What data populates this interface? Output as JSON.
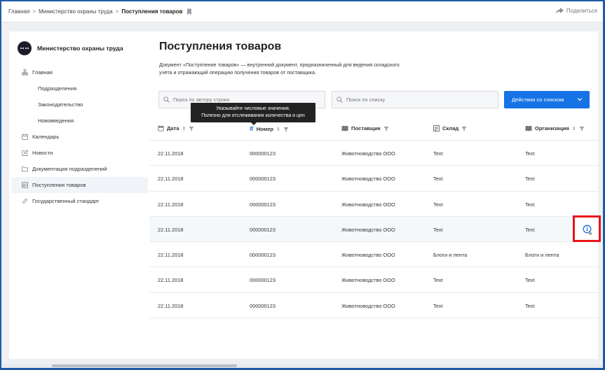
{
  "breadcrumb": {
    "items": [
      "Главная",
      "Министерство охраны труда",
      "Поступления товаров"
    ],
    "separator": ">"
  },
  "share_label": "Поделиться",
  "org_name": "Министерство охраны труда",
  "sidebar": {
    "items": [
      {
        "label": "Главная",
        "icon": "structure-icon",
        "level": 0
      },
      {
        "label": "Подразделения",
        "icon": "",
        "level": 1
      },
      {
        "label": "Законодательство",
        "icon": "",
        "level": 1
      },
      {
        "label": "Нововведения",
        "icon": "",
        "level": 1
      },
      {
        "label": "Календарь",
        "icon": "calendar-icon",
        "level": 0
      },
      {
        "label": "Новости",
        "icon": "edit-icon",
        "level": 0
      },
      {
        "label": "Документация подразделений",
        "icon": "folder-icon",
        "level": 0
      },
      {
        "label": "Поступления товаров",
        "icon": "table-icon",
        "level": 0,
        "active": true
      },
      {
        "label": "Государственный стандарт",
        "icon": "link-icon",
        "level": 0
      }
    ]
  },
  "page": {
    "title": "Поступления товаров",
    "description": "Документ «Поступление товаров» — внутренний документ, предназначенный для ведения складского учёта и отражающий операцию получения товаров от поставщика."
  },
  "search": {
    "author_placeholder": "Поиск по автору строки",
    "list_placeholder": "Поиск по списку"
  },
  "actions_button": "Действия со списком",
  "tooltip": {
    "line1": "Указывайте числовые значения.",
    "line2": "Полезно для отслеживания количества и цен"
  },
  "table": {
    "columns": [
      {
        "label": "Дата",
        "icon": "calendar-icon"
      },
      {
        "label": "Номер",
        "icon": "hash-icon"
      },
      {
        "label": "Поставщик",
        "icon": "book-icon"
      },
      {
        "label": "Склад",
        "icon": "list-icon"
      },
      {
        "label": "Организация",
        "icon": "book-icon"
      }
    ],
    "rows": [
      [
        "22.11.2018",
        "000000123",
        "Животноводство ООО",
        "Text",
        "Text"
      ],
      [
        "22.11.2018",
        "000000123",
        "Животноводство ООО",
        "Text",
        "Text"
      ],
      [
        "22.11.2018",
        "000000123",
        "Животноводство ООО",
        "Text",
        "Text"
      ],
      [
        "22.11.2018",
        "000000123",
        "Животноводство ООО",
        "Text",
        "Text"
      ],
      [
        "22.11.2018",
        "000000123",
        "Животноводство ООО",
        "Блоги и лента",
        "Блоги и лента"
      ],
      [
        "22.11.2018",
        "000000123",
        "Животноводство ООО",
        "Text",
        "Text"
      ],
      [
        "22.11.2018",
        "000000123",
        "Животноводство ООО",
        "Text",
        "Text"
      ]
    ],
    "highlighted_row": 3
  },
  "colors": {
    "accent": "#1673e6",
    "highlight_box": "#e8141b",
    "frame": "#1f5aa8"
  }
}
